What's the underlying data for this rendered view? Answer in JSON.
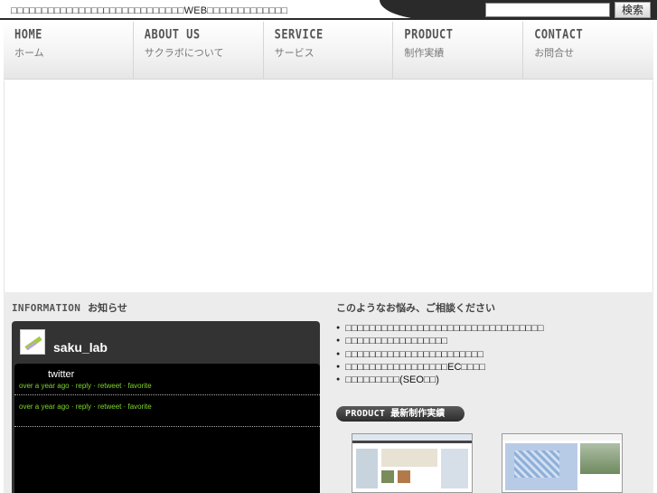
{
  "header": {
    "tagline": "□□□□□□□□□□□□□□□□□□□□□□□□□□□□WEB□□□□□□□□□□□□□",
    "search": {
      "value": "",
      "placeholder": "",
      "button_label": "検索"
    }
  },
  "nav": {
    "items": [
      {
        "en": "HOME",
        "ja": "ホーム"
      },
      {
        "en": "ABOUT US",
        "ja": "サクラボについて"
      },
      {
        "en": "SERVICE",
        "ja": "サービス"
      },
      {
        "en": "PRODUCT",
        "ja": "制作実績"
      },
      {
        "en": "CONTACT",
        "ja": "お問合せ"
      }
    ]
  },
  "information": {
    "heading_en": "INFORMATION",
    "heading_ja": "お知らせ",
    "twitter": {
      "username": "saku_lab",
      "tweets": [
        {
          "text": "twitter",
          "meta": "over a year ago · reply · retweet · favorite"
        },
        {
          "text": "",
          "meta": "over a year ago · reply · retweet · favorite"
        }
      ]
    }
  },
  "consult": {
    "heading": "このようなお悩み、ご相談ください",
    "items": [
      "□□□□□□□□□□□□□□□□□□□□□□□□□□□□□□□□□",
      "□□□□□□□□□□□□□□□□□",
      "□□□□□□□□□□□□□□□□□□□□□□□",
      "□□□□□□□□□□□□□□□□□EC□□□□",
      "□□□□□□□□□(SEO□□)"
    ]
  },
  "product": {
    "heading_en": "PRODUCT",
    "heading_ja": "最新制作実績"
  },
  "colors": {
    "header_dark": "#2a2a2a",
    "twitter_panel": "#333333",
    "tweet_meta": "#7fd62b",
    "lower_bg": "#ececec"
  }
}
